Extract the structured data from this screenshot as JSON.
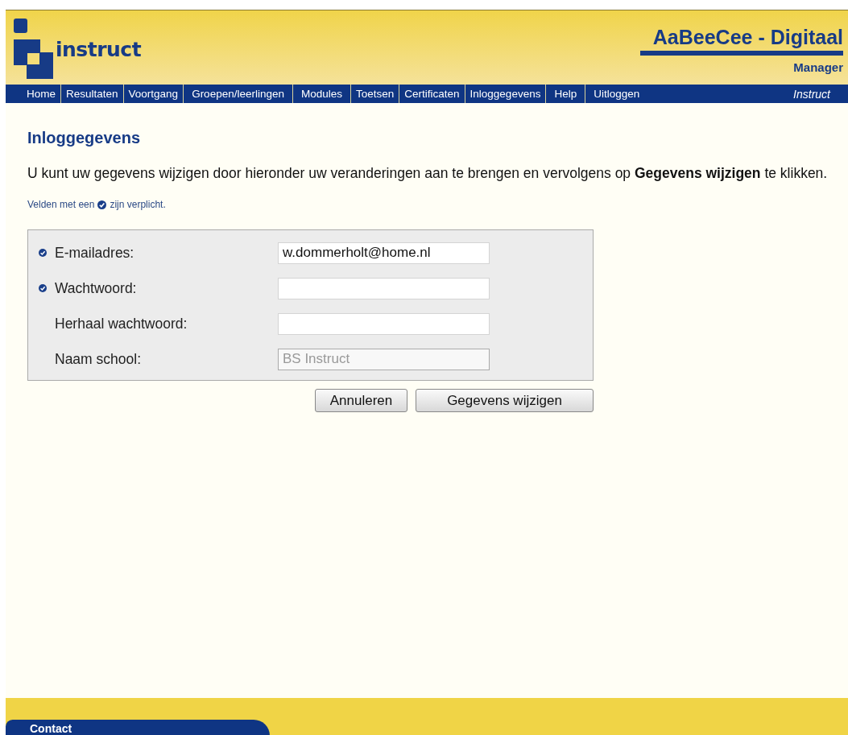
{
  "header": {
    "logo_text": "instruct",
    "title": "AaBeeCee - Digitaal",
    "subtitle": "Manager"
  },
  "nav": {
    "items": [
      {
        "label": "Home"
      },
      {
        "label": "Resultaten"
      },
      {
        "label": "Voortgang"
      },
      {
        "label": "Groepen/leerlingen"
      },
      {
        "label": "Modules"
      },
      {
        "label": "Toetsen"
      },
      {
        "label": "Certificaten"
      },
      {
        "label": "Inloggegevens"
      },
      {
        "label": "Help"
      },
      {
        "label": "Uitloggen"
      }
    ],
    "brand": "Instruct"
  },
  "page": {
    "heading": "Inloggegevens",
    "intro": "U kunt uw gegevens wijzigen door hieronder uw veranderingen aan te brengen en vervolgens op **Gegevens wijzigen** te klikken.",
    "required_note": {
      "before": "Velden met een",
      "after": "zijn verplicht."
    }
  },
  "form": {
    "fields": [
      {
        "label": "E-mailadres:",
        "required": true,
        "value": "w.dommerholt@home.nl",
        "disabled": false
      },
      {
        "label": "Wachtwoord:",
        "required": true,
        "disabled": false
      },
      {
        "label": "Herhaal wachtwoord:",
        "required": false,
        "disabled": false
      },
      {
        "label": "Naam school:",
        "required": false,
        "value": "BS Instruct",
        "disabled": true
      }
    ],
    "buttons": [
      "Annuleren",
      "Gegevens wijzigen"
    ]
  },
  "footer": {
    "tab": "Contact"
  }
}
